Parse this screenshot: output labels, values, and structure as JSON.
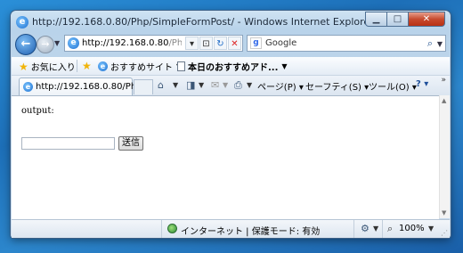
{
  "window": {
    "title": "http://192.168.0.80/Php/SimpleFormPost/ - Windows Internet Explorer",
    "controls": {
      "minimize": "▁",
      "maximize": "□",
      "close": "✕"
    }
  },
  "nav": {
    "address_host": "http://192.168.0.80",
    "address_path": "/Php/S",
    "search_placeholder": "Google"
  },
  "favorites_bar": {
    "favorites_label": "お気に入り",
    "suggested_sites_label": "おすすめサイト",
    "todays_picks_label": "本日のおすすめアド..."
  },
  "tab": {
    "title": "http://192.168.0.80/Ph..."
  },
  "command_bar": {
    "page_label": "ページ(P)",
    "safety_label": "セーフティ(S)",
    "tools_label": "ツール(O)"
  },
  "page": {
    "output_label": "output:",
    "input_value": "",
    "submit_label": "送信"
  },
  "status": {
    "zone_text": "インターネット | 保護モード: 有効",
    "zoom": "100%"
  },
  "colors": {
    "desktop": "#2a8fd8",
    "window_frame": "#c9dcee",
    "close_button": "#c74a2e"
  }
}
